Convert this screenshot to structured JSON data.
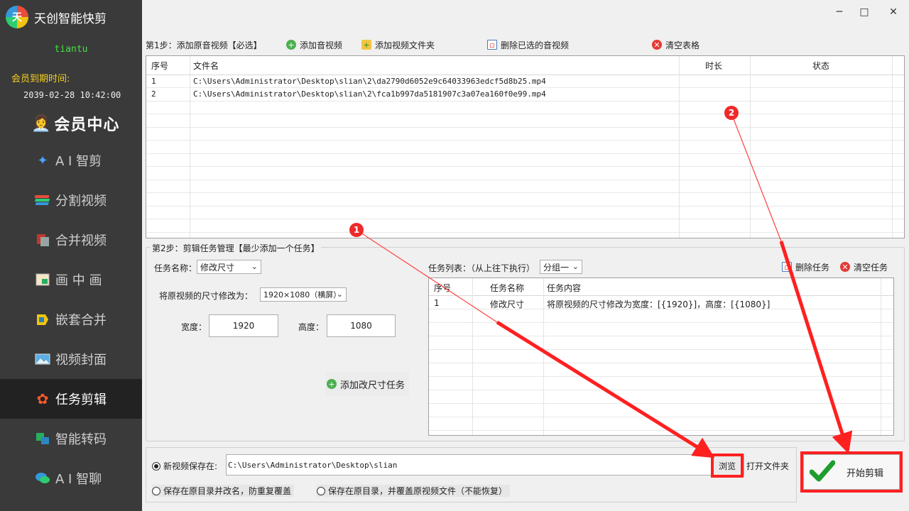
{
  "app": {
    "title": "天创智能快剪",
    "logo_glyph": "天",
    "username": "tiantu",
    "expire_label": "会员到期时间:",
    "expire_date": "2039-02-28 10:42:00",
    "member_center": "会员中心"
  },
  "nav": [
    {
      "label": "A I 智剪",
      "icon": "ai-edit-icon",
      "active": false
    },
    {
      "label": "分割视频",
      "icon": "split-video-icon",
      "active": false
    },
    {
      "label": "合并视频",
      "icon": "merge-video-icon",
      "active": false
    },
    {
      "label": "画 中 画",
      "icon": "picture-in-picture-icon",
      "active": false
    },
    {
      "label": "嵌套合并",
      "icon": "nest-merge-icon",
      "active": false
    },
    {
      "label": "视频封面",
      "icon": "video-cover-icon",
      "active": false
    },
    {
      "label": "任务剪辑",
      "icon": "task-edit-icon",
      "active": true
    },
    {
      "label": "智能转码",
      "icon": "transcode-icon",
      "active": false
    },
    {
      "label": "A I 智聊",
      "icon": "ai-chat-icon",
      "active": false
    }
  ],
  "step1": {
    "label": "第1步：添加原音视频【必选】",
    "add_av": "添加音视频",
    "add_folder": "添加视频文件夹",
    "delete_selected": "删除已选的音视频",
    "clear_table": "清空表格",
    "columns": [
      "序号",
      "文件名",
      "时长",
      "状态"
    ],
    "rows": [
      {
        "index": "1",
        "file": "C:\\Users\\Administrator\\Desktop\\slian\\2\\da2790d6052e9c64033963edcf5d8b25.mp4",
        "duration": "",
        "status": ""
      },
      {
        "index": "2",
        "file": "C:\\Users\\Administrator\\Desktop\\slian\\2\\fca1b997da5181907c3a07ea160f0e99.mp4",
        "duration": "",
        "status": ""
      }
    ]
  },
  "step2": {
    "label": "第2步：剪辑任务管理【最少添加一个任务】",
    "task_name_label": "任务名称：",
    "task_name_value": "修改尺寸",
    "resize_label": "将原视频的尺寸修改为：",
    "resize_value": "1920×1080（横屏）",
    "width_label": "宽度：",
    "width_value": "1920",
    "height_label": "高度：",
    "height_value": "1080",
    "add_task_button": "添加改尺寸任务",
    "task_list_label": "任务列表：（从上往下执行）",
    "group_value": "分组一",
    "delete_task": "删除任务",
    "clear_tasks": "清空任务",
    "task_columns": [
      "序号",
      "任务名称",
      "任务内容"
    ],
    "tasks": [
      {
        "index": "1",
        "name": "修改尺寸",
        "content": "将原视频的尺寸修改为宽度：[{1920}]，高度：[{1080}]"
      }
    ]
  },
  "output": {
    "save_new_label": "新视频保存在:",
    "save_path": "C:\\Users\\Administrator\\Desktop\\slian",
    "browse": "浏览",
    "open_folder": "打开文件夹",
    "option_rename": "保存在原目录并改名，防重复覆盖",
    "option_overwrite": "保存在原目录，并覆盖原视频文件（不能恢复）",
    "start_button": "开始剪辑"
  },
  "annotations": {
    "badge1": "1",
    "badge2": "2",
    "arrow_color": "#ff2020"
  },
  "window": {
    "minimize": "─",
    "maximize": "□",
    "close": "✕"
  }
}
